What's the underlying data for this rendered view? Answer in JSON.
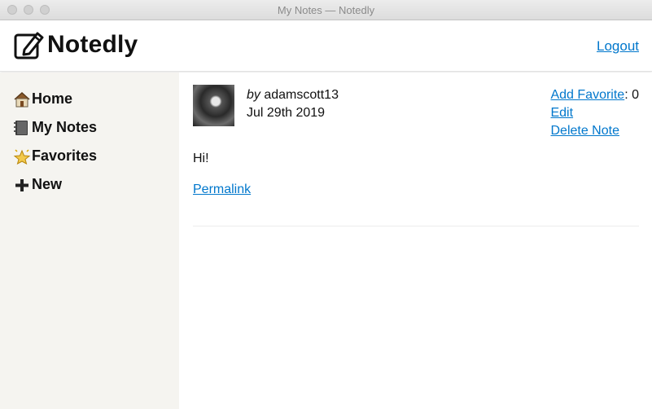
{
  "window": {
    "title": "My Notes — Notedly"
  },
  "header": {
    "brand": "Notedly",
    "logout_label": "Logout"
  },
  "sidebar": {
    "items": [
      {
        "label": "Home",
        "icon": "house-icon"
      },
      {
        "label": "My Notes",
        "icon": "notebook-icon"
      },
      {
        "label": "Favorites",
        "icon": "star-icon"
      },
      {
        "label": "New",
        "icon": "plus-icon"
      }
    ]
  },
  "note": {
    "by_prefix": "by",
    "author": "adamscott13",
    "date": "Jul 29th 2019",
    "add_favorite_label": "Add Favorite",
    "favorite_count": ": 0",
    "edit_label": "Edit",
    "delete_label": "Delete Note",
    "content": "Hi!",
    "permalink_label": "Permalink"
  },
  "colors": {
    "link": "#0077cc",
    "sidebar_bg": "#f5f4f0"
  }
}
